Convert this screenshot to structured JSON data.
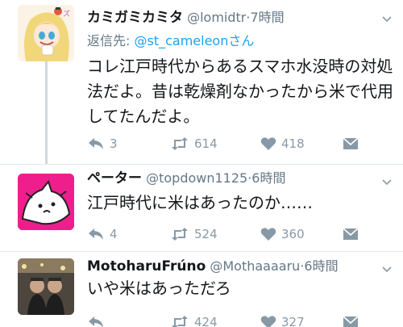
{
  "tweets": [
    {
      "name": "カミガミカミタ",
      "handle": "@lomidtr",
      "time": "7時間",
      "reply_prefix": "返信先: ",
      "reply_target": "@st_cameleonさん",
      "text": "コレ江戸時代からあるスマホ水没時の対処法だよ。昔は乾燥剤なかったから米で代用してたんだよ。",
      "replies": "3",
      "retweets": "614",
      "likes": "418"
    },
    {
      "name": "ペーター",
      "handle": "@topdown1125",
      "time": "6時間",
      "text": "江戸時代に米はあったのか……",
      "replies": "4",
      "retweets": "524",
      "likes": "360"
    },
    {
      "name": "MotoharuFrúno",
      "handle": "@Mothaaaaru",
      "time": "6時間",
      "text": "いや米はあっただろ",
      "replies": "",
      "retweets": "424",
      "likes": "327"
    }
  ],
  "separator": "·",
  "icons": {
    "reply": "reply-icon",
    "retweet": "retweet-icon",
    "like": "heart-icon",
    "dm": "envelope-icon",
    "menu": "chevron-down-icon"
  },
  "colors": {
    "text": "#14171a",
    "muted": "#657786",
    "action": "#8899a6",
    "link": "#1da1f2",
    "thread": "#cfd9de"
  }
}
